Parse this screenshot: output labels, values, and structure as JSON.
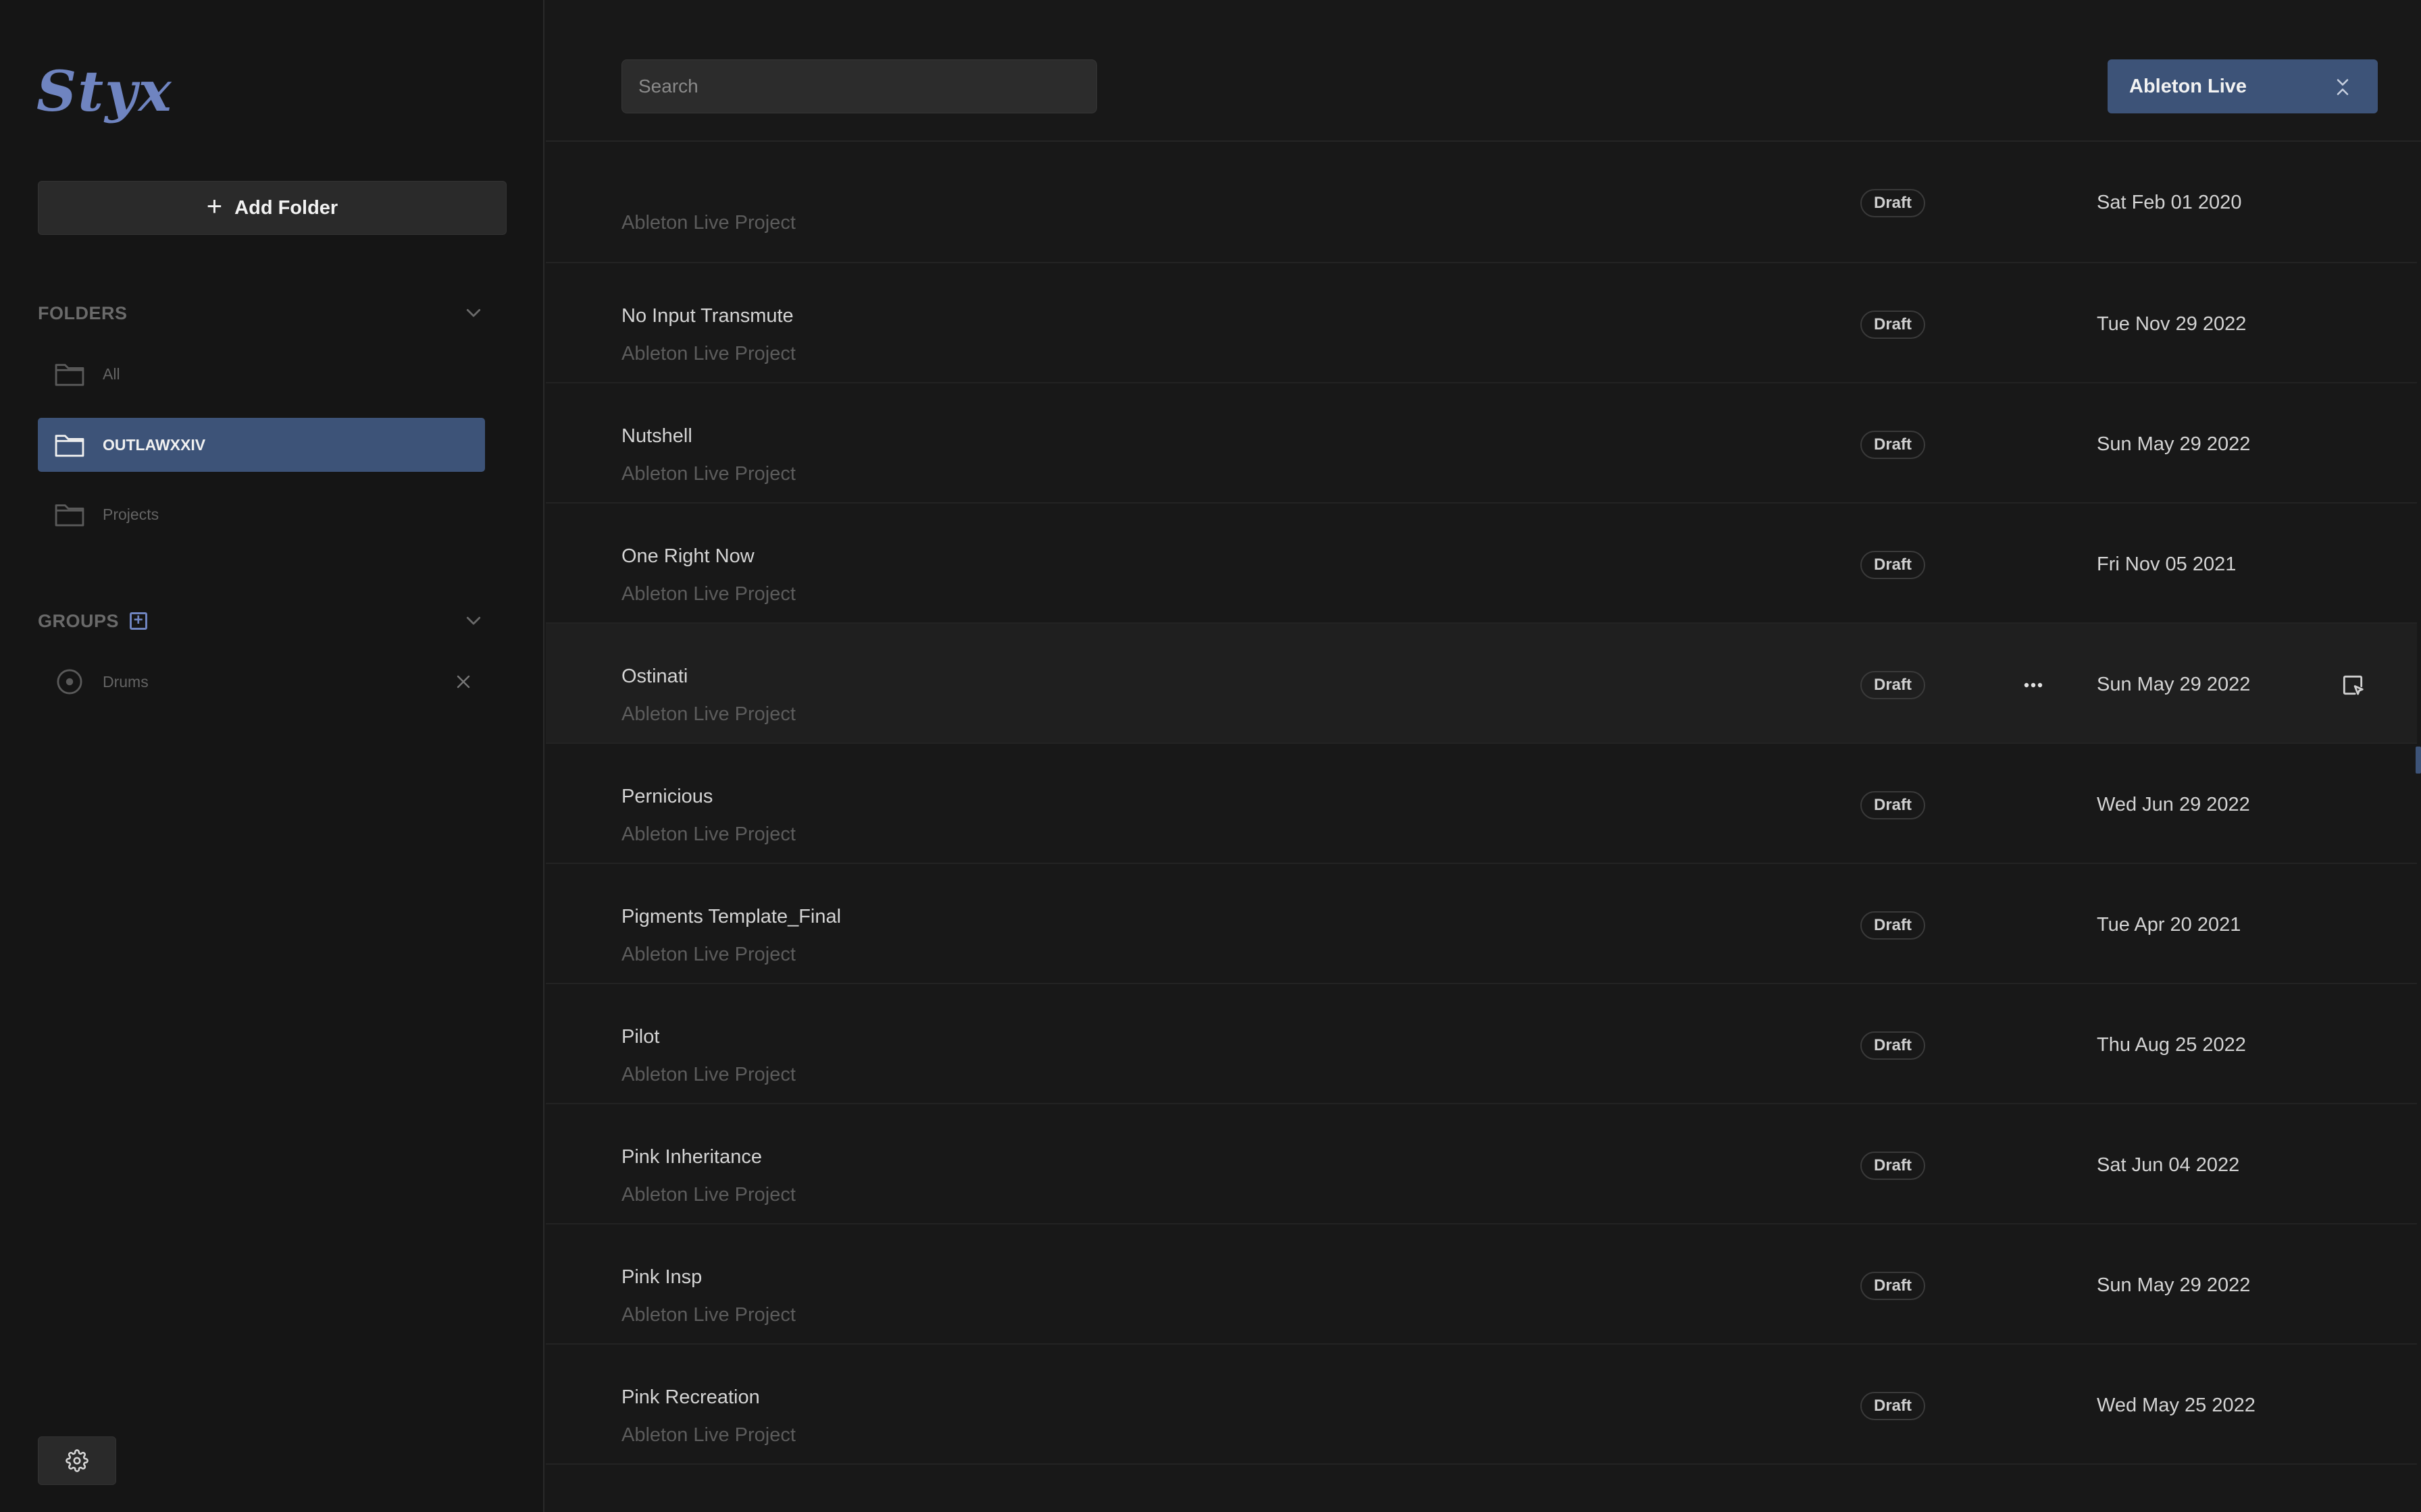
{
  "app": {
    "logo": "Styx",
    "accent": "#3d5378",
    "logo_color": "#6f84c0"
  },
  "sidebar": {
    "add_folder_label": "Add Folder",
    "folders_heading": "FOLDERS",
    "folders": [
      {
        "label": "All",
        "active": false
      },
      {
        "label": "OUTLAWXXIV",
        "active": true
      },
      {
        "label": "Projects",
        "active": false
      }
    ],
    "groups_heading": "GROUPS",
    "groups": [
      {
        "label": "Drums"
      }
    ]
  },
  "toolbar": {
    "search_placeholder": "Search",
    "daw_selected": "Ableton Live"
  },
  "projects": [
    {
      "name": "",
      "type": "Ableton Live Project",
      "status": "Draft",
      "date": "Sat Feb 01 2020"
    },
    {
      "name": "No Input Transmute",
      "type": "Ableton Live Project",
      "status": "Draft",
      "date": "Tue Nov 29 2022"
    },
    {
      "name": "Nutshell",
      "type": "Ableton Live Project",
      "status": "Draft",
      "date": "Sun May 29 2022"
    },
    {
      "name": "One Right Now",
      "type": "Ableton Live Project",
      "status": "Draft",
      "date": "Fri Nov 05 2021"
    },
    {
      "name": "Ostinati",
      "type": "Ableton Live Project",
      "status": "Draft",
      "date": "Sun May 29 2022",
      "hovered": true
    },
    {
      "name": "Pernicious",
      "type": "Ableton Live Project",
      "status": "Draft",
      "date": "Wed Jun 29 2022"
    },
    {
      "name": "Pigments Template_Final",
      "type": "Ableton Live Project",
      "status": "Draft",
      "date": "Tue Apr 20 2021"
    },
    {
      "name": "Pilot",
      "type": "Ableton Live Project",
      "status": "Draft",
      "date": "Thu Aug 25 2022"
    },
    {
      "name": "Pink Inheritance",
      "type": "Ableton Live Project",
      "status": "Draft",
      "date": "Sat Jun 04 2022"
    },
    {
      "name": "Pink Insp",
      "type": "Ableton Live Project",
      "status": "Draft",
      "date": "Sun May 29 2022"
    },
    {
      "name": "Pink Recreation",
      "type": "Ableton Live Project",
      "status": "Draft",
      "date": "Wed May 25 2022"
    }
  ]
}
